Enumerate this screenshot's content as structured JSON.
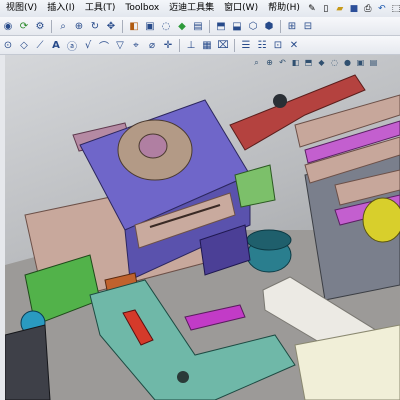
{
  "menu": {
    "items": [
      "视图(V)",
      "插入(I)",
      "工具(T)",
      "Toolbox",
      "迈迪工具集",
      "窗口(W)",
      "帮助(H)"
    ],
    "icons": [
      "pin-icon",
      "new-doc-icon",
      "open-icon",
      "save-icon",
      "print-icon",
      "undo-icon",
      "select-icon"
    ]
  },
  "toolbar1": {
    "icons": [
      "view-icon",
      "rebuild-icon",
      "options-icon",
      "zoom-fit-icon",
      "zoom-area-icon",
      "rotate-icon",
      "pan-icon",
      "section-icon",
      "display-icon",
      "hide-icon",
      "appearance-icon",
      "scene-icon",
      "standard-views-icon",
      "view-orientation-icon",
      "wireframe-icon",
      "shaded-icon"
    ]
  },
  "toolbar2": {
    "icons": [
      "sketch-icon",
      "smart-dim-icon",
      "line-icon",
      "note-icon",
      "balloon-icon",
      "surface-finish-icon",
      "weld-icon",
      "datum-icon",
      "geometric-tol-icon",
      "hole-callout-icon",
      "centermark-icon",
      "centerline-icon",
      "table-icon",
      "revision-icon",
      "layer-icon",
      "format-icon",
      "measure-icon"
    ]
  },
  "hud": {
    "icons": [
      "zoom-fit-icon",
      "zoom-area-icon",
      "prev-view-icon",
      "section-view-icon",
      "view-orient-icon",
      "display-style-icon",
      "hide-show-icon",
      "edit-appearance-icon",
      "apply-scene-icon",
      "view-settings-icon"
    ]
  },
  "colors": {
    "purple": "#6f66c9",
    "tan": "#c7a79b",
    "pink": "#a87d94",
    "green": "#52b24a",
    "teal": "#6fb8a8",
    "red_handle": "#b4423f",
    "yellow": "#d8cf2c",
    "gray_block": "#7a7f8c",
    "magenta": "#c23bc7",
    "cyan": "#2a7e8e"
  }
}
